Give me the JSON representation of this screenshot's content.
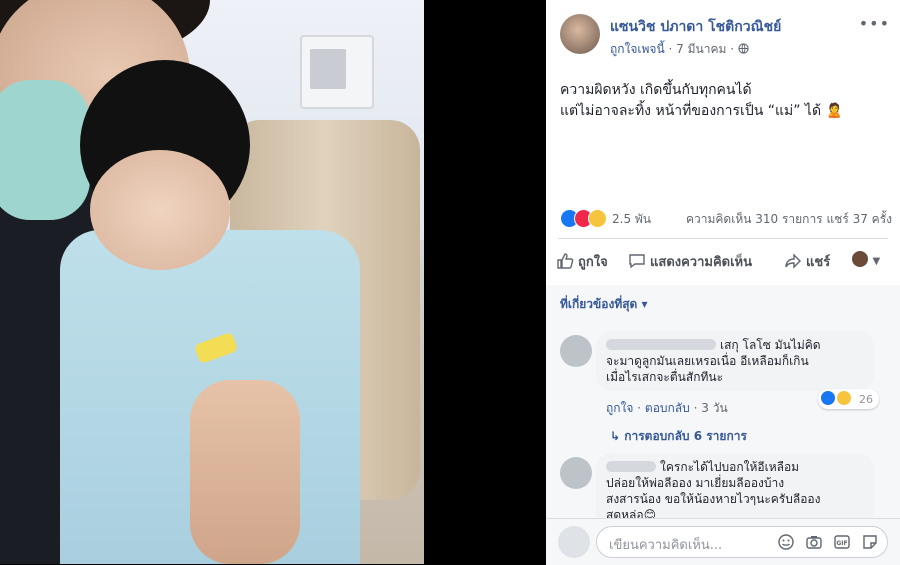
{
  "post": {
    "author": "แซนวิช ปภาดา โชติกวณิชย์",
    "feeling": "ถูกใจเพจนี้",
    "separator": "·",
    "date": "7 มีนาคม",
    "dot": "·",
    "more_icon": "more-icon",
    "lines": [
      "ความผิดหวัง เกิดขึ้นกับทุกคนได้",
      "แต่ไม่อาจละทิ้ง หน้าที่ของการเป็น “แม่” ได้ 🙎"
    ]
  },
  "stats": {
    "reactions": "2.5 พัน",
    "comments_shares": "ความคิดเห็น 310 รายการ  แชร์ 37 ครั้ง",
    "reaction_icons": [
      "like-icon",
      "love-icon",
      "sad-icon"
    ]
  },
  "actions": {
    "like": "ถูกใจ",
    "comment": "แสดงความคิดเห็น",
    "share": "แชร์"
  },
  "comments": {
    "sort_label": "ที่เกี่ยวข้องที่สุด ▾",
    "items": [
      {
        "text_lines": [
          "เสกุ โลโซ มันไม่คิด",
          "จะมาดูลูกมันเลยเหรอเนื่อ อีเหลือมก็เกิน",
          "เมื่อไรเสกจะตื่นสักทีนะ"
        ],
        "like": "ถูกใจ",
        "reply": "ตอบกลับ",
        "time": "3 วัน",
        "sep": "·",
        "react_count": "26"
      },
      {
        "replies": "↳  การตอบกลับ 6 รายการ"
      },
      {
        "text_lines": [
          "ใครกะได้ไปบอกให้อีเหลือม",
          "ปล่อยให้พ่อลีออง มาเยี่ยมลีอองบ้าง",
          "สงสารน้อง ขอให้น้องหายไวๆนะครับลีออง",
          "สุดหล่อ😊"
        ]
      }
    ]
  },
  "composer": {
    "placeholder": "เขียนความคิดเห็น...",
    "tools": [
      "emoji-icon",
      "camera-icon",
      "gif-icon",
      "sticker-icon"
    ]
  }
}
